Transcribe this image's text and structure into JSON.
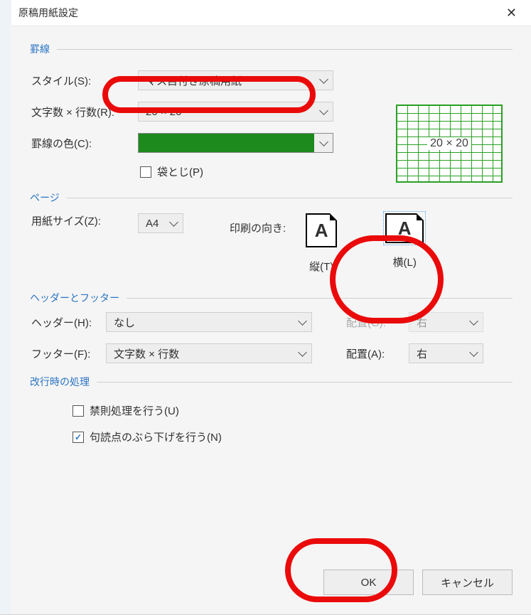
{
  "dialog": {
    "title": "原稿用紙設定",
    "close_glyph": "✕"
  },
  "grid_lines": {
    "group_label": "罫線",
    "style_label": "スタイル(S):",
    "style_value": "マス目付き原稿用紙",
    "chars_rows_label": "文字数 × 行数(R):",
    "chars_rows_value": "20 × 20",
    "line_color_label": "罫線の色(C):",
    "line_color_hex": "#1d8a1d",
    "fold_label": "袋とじ(P)",
    "fold_checked": false,
    "preview_text": "20 × 20"
  },
  "page": {
    "group_label": "ページ",
    "paper_size_label": "用紙サイズ(Z):",
    "paper_size_value": "A4",
    "orientation_label": "印刷の向き:",
    "portrait_label": "縦(T)",
    "landscape_label": "横(L)",
    "icon_glyph": "A"
  },
  "header_footer": {
    "group_label": "ヘッダーとフッター",
    "header_label": "ヘッダー(H):",
    "header_value": "なし",
    "header_align_label": "配置(G):",
    "header_align_value": "右",
    "footer_label": "フッター(F):",
    "footer_value": "文字数 × 行数",
    "footer_align_label": "配置(A):",
    "footer_align_value": "右"
  },
  "linebreak": {
    "group_label": "改行時の処理",
    "kinsoku_label": "禁則処理を行う(U)",
    "kinsoku_checked": false,
    "hang_label": "句読点のぶら下げを行う(N)",
    "hang_checked": true
  },
  "buttons": {
    "ok": "OK",
    "cancel": "キャンセル"
  }
}
